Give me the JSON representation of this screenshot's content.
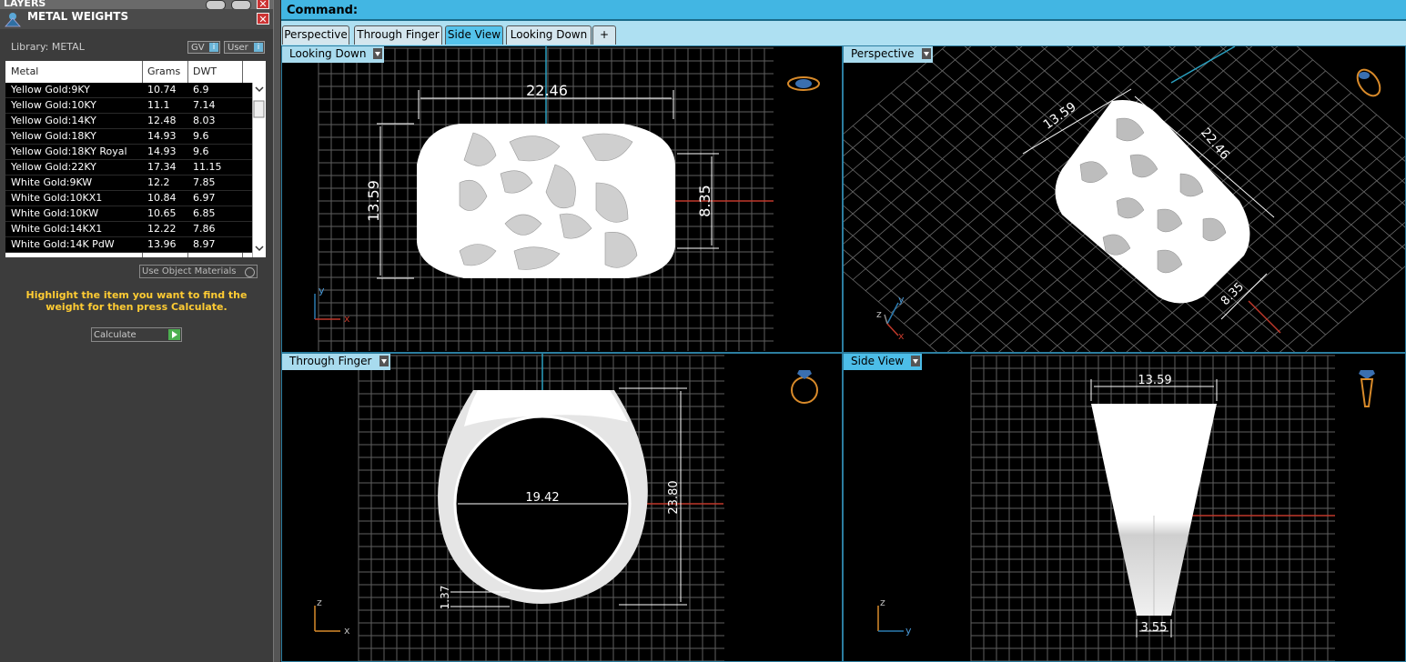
{
  "layers_title": "LAYERS",
  "panel": {
    "title": "METAL WEIGHTS",
    "library": "Library: METAL",
    "chip_gv": "GV",
    "chip_user": "User",
    "columns": [
      "Metal",
      "Grams",
      "DWT"
    ],
    "rows": [
      [
        "Yellow Gold:9KY",
        "10.74",
        "6.9"
      ],
      [
        "Yellow Gold:10KY",
        "11.1",
        "7.14"
      ],
      [
        "Yellow Gold:14KY",
        "12.48",
        "8.03"
      ],
      [
        "Yellow Gold:18KY",
        "14.93",
        "9.6"
      ],
      [
        "Yellow Gold:18KY Royal",
        "14.93",
        "9.6"
      ],
      [
        "Yellow Gold:22KY",
        "17.34",
        "11.15"
      ],
      [
        "White Gold:9KW",
        "12.2",
        "7.85"
      ],
      [
        "White Gold:10KX1",
        "10.84",
        "6.97"
      ],
      [
        "White Gold:10KW",
        "10.65",
        "6.85"
      ],
      [
        "White Gold:14KX1",
        "12.22",
        "7.86"
      ],
      [
        "White Gold:14K PdW",
        "13.96",
        "8.97"
      ]
    ],
    "use_object_materials": "Use Object Materials",
    "hint": "Highlight the item you want to find the weight for then press Calculate.",
    "calculate": "Calculate"
  },
  "command_label": "Command:",
  "tabs": [
    "Perspective",
    "Through Finger",
    "Side View",
    "Looking Down",
    "+"
  ],
  "active_tab": "Side View",
  "viewports": {
    "looking_down": {
      "label": "Looking Down",
      "dim_width": "22.46",
      "dim_height": "13.59",
      "dim_right": "8.35",
      "axis_1": "y",
      "axis_2": "x"
    },
    "perspective": {
      "label": "Perspective",
      "dim_a": "13.59",
      "dim_b": "22.46",
      "dim_c": "8.35",
      "axis_1": "y",
      "axis_2": "z",
      "axis_3": "x"
    },
    "through_finger": {
      "label": "Through Finger",
      "dim_inner": "19.42",
      "dim_height": "23.80",
      "dim_shank": "1.37",
      "axis_1": "z",
      "axis_2": "x"
    },
    "side_view": {
      "label": "Side View",
      "dim_top": "13.59",
      "dim_bottom": "3.55",
      "axis_1": "z",
      "axis_2": "y"
    }
  },
  "colors": {
    "accent": "#42b6e3",
    "hint": "#ffcc33",
    "axis_red": "#c0392b",
    "axis_cyan": "#2aa0c0",
    "grid": "#6a6a6a"
  }
}
